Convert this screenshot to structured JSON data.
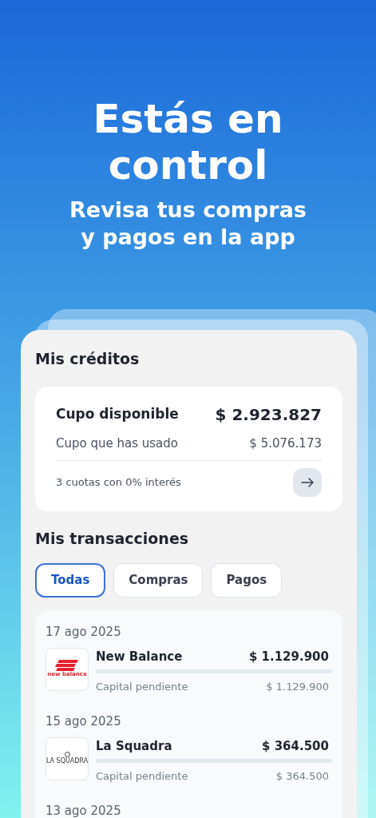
{
  "hero": {
    "title_lines": [
      "Estás en",
      "control"
    ],
    "subtitle_lines": [
      "Revisa tus compras",
      "y pagos en la app"
    ]
  },
  "credits": {
    "title": "Mis créditos",
    "available_label": "Cupo disponible",
    "available_amount": "$ 2.923.827",
    "used_label": "Cupo que has usado",
    "used_amount": "$ 5.076.173",
    "promo": "3 cuotas con 0% interés"
  },
  "transactions": {
    "title": "Mis transacciones",
    "filters": [
      {
        "label": "Todas",
        "selected": true
      },
      {
        "label": "Compras",
        "selected": false
      },
      {
        "label": "Pagos",
        "selected": false
      }
    ],
    "groups": [
      {
        "date": "17 ago 2025",
        "items": [
          {
            "kind": "red-logo",
            "logo_text": "new balance",
            "name": "New Balance",
            "amount": "$ 1.129.900",
            "detail_label": "Capital pendiente",
            "detail_amount": "$ 1.129.900",
            "level": 0
          }
        ]
      },
      {
        "date": "15 ago 2025",
        "items": [
          {
            "kind": "dark-logo",
            "logo_text": "LA SQUADRA",
            "name": "La Squadra",
            "amount": "$ 364.500",
            "detail_label": "Capital pendiente",
            "detail_amount": "$ 364.500",
            "level": 0
          }
        ]
      },
      {
        "date": "13 ago 2025"
      }
    ]
  }
}
